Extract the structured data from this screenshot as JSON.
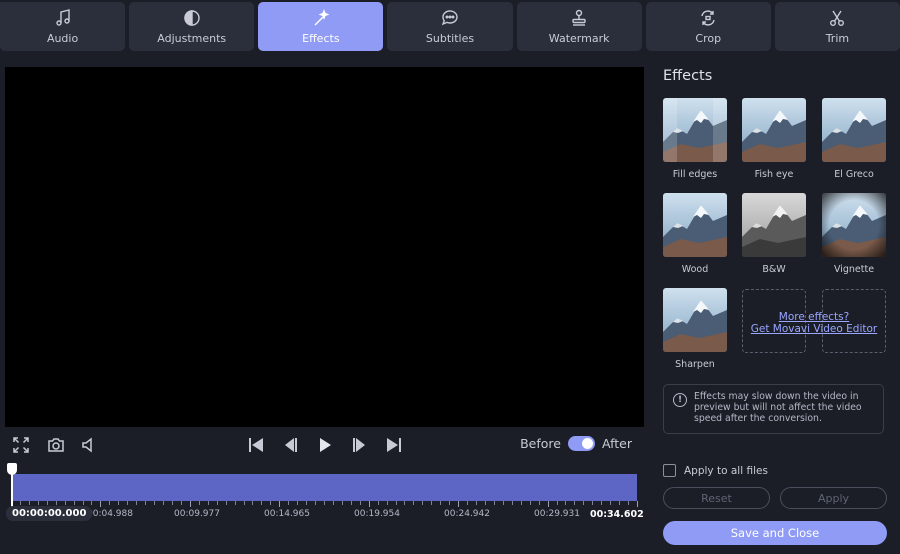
{
  "tabs": [
    {
      "label": "Audio",
      "icon": "music-note-icon",
      "active": false
    },
    {
      "label": "Adjustments",
      "icon": "contrast-icon",
      "active": false
    },
    {
      "label": "Effects",
      "icon": "magic-wand-icon",
      "active": true
    },
    {
      "label": "Subtitles",
      "icon": "speech-bubble-icon",
      "active": false
    },
    {
      "label": "Watermark",
      "icon": "stamp-icon",
      "active": false
    },
    {
      "label": "Crop",
      "icon": "crop-rotate-icon",
      "active": false
    },
    {
      "label": "Trim",
      "icon": "scissors-icon",
      "active": false
    }
  ],
  "player": {
    "before_label": "Before",
    "after_label": "After",
    "toggle_on": true
  },
  "timeline": {
    "current_time": "00:00:00.000",
    "end_time": "00:34.602",
    "marks": [
      "00:04.988",
      "00:09.977",
      "00:14.965",
      "00:19.954",
      "00:24.942",
      "00:29.931"
    ]
  },
  "effects_panel": {
    "title": "Effects",
    "effects": [
      {
        "label": "Fill edges"
      },
      {
        "label": "Fish eye"
      },
      {
        "label": "El Greco"
      },
      {
        "label": "Wood"
      },
      {
        "label": "B&W"
      },
      {
        "label": "Vignette"
      },
      {
        "label": "Sharpen"
      }
    ],
    "more_link_line1": "More effects?",
    "more_link_line2": "Get Movavi Video Editor",
    "info_text": "Effects may slow down the video in preview but will not affect the video speed after the conversion.",
    "apply_all_label": "Apply to all files",
    "reset_label": "Reset",
    "apply_label": "Apply",
    "save_close_label": "Save and Close"
  },
  "colors": {
    "accent": "#8f9bf5",
    "background": "#1b1e27",
    "tab_background": "#2b2f3b",
    "timeline": "#5d66c4"
  }
}
